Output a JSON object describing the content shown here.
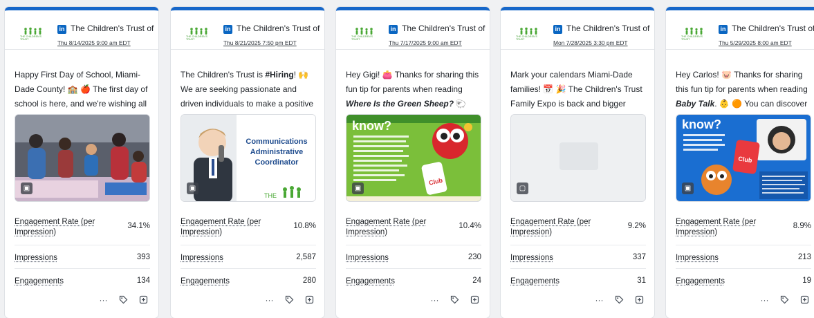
{
  "colors": {
    "accent": "#1767c9",
    "linkedin": "#0a66c2"
  },
  "cards": [
    {
      "account": "The Children's Trust of ...",
      "date": "Thu 8/14/2025 9:00 am EDT",
      "text_a": "Happy First Day of School, Miami-Dade County! 🏫 🍎 The first day of school is here, and we're wishing all students…",
      "media_type": "image-icon",
      "metrics": {
        "er_label": "Engagement Rate (per Impression)",
        "er": "34.1%",
        "imp_label": "Impressions",
        "imp": "393",
        "eng_label": "Engagements",
        "eng": "134"
      }
    },
    {
      "account": "The Children's Trust of ...",
      "date": "Thu 8/21/2025 7:50 pm EDT",
      "text_a": "The Children's Trust is ",
      "text_b": "#Hiring",
      "text_c": "! 🙌 We are seeking passionate and driven individuals to make a positive impact ...",
      "image_title_1": "Communications",
      "image_title_2": "Administrative",
      "image_title_3": "Coordinator",
      "image_logo": "THE",
      "media_type": "image-icon",
      "metrics": {
        "er_label": "Engagement Rate (per Impression)",
        "er": "10.8%",
        "imp_label": "Impressions",
        "imp": "2,587",
        "eng_label": "Engagements",
        "eng": "280"
      }
    },
    {
      "account": "The Children's Trust of ...",
      "date": "Thu 7/17/2025 9:00 am EDT",
      "text_a": "Hey Gigi! 👛 Thanks for sharing this fun tip for parents when reading ",
      "text_b": "Where Is the Green Sheep?",
      "text_c": " 🐑 🍏...",
      "image_heading": "know?",
      "image_tag": "Club",
      "media_type": "image-icon",
      "metrics": {
        "er_label": "Engagement Rate (per Impression)",
        "er": "10.4%",
        "imp_label": "Impressions",
        "imp": "230",
        "eng_label": "Engagements",
        "eng": "24"
      }
    },
    {
      "account": "The Children's Trust of ...",
      "date": "Mon 7/28/2025 3:30 pm EDT",
      "text_a": "Mark your calendars Miami-Dade families! 📅 🎉 The Children's Trust Family Expo is back and bigger than...",
      "media_type": "video-icon",
      "metrics": {
        "er_label": "Engagement Rate (per Impression)",
        "er": "9.2%",
        "imp_label": "Impressions",
        "imp": "337",
        "eng_label": "Engagements",
        "eng": "31"
      }
    },
    {
      "account": "The Children's Trust of ...",
      "date": "Thu 5/29/2025 8:00 am EDT",
      "text_a": "Hey Carlos! 🐷 Thanks for sharing this fun tip for parents when reading ",
      "text_b": "Baby Talk",
      "text_c": ". 👶 🟠 You can discover more…",
      "image_heading": "know?",
      "image_tag": "Club",
      "media_type": "image-icon",
      "metrics": {
        "er_label": "Engagement Rate (per Impression)",
        "er": "8.9%",
        "imp_label": "Impressions",
        "imp": "213",
        "eng_label": "Engagements",
        "eng": "19"
      }
    }
  ],
  "logo_text": "THE CHILDREN'S TRUST",
  "actions": {
    "more": "···",
    "tag": "tag-icon",
    "note": "note-icon"
  }
}
